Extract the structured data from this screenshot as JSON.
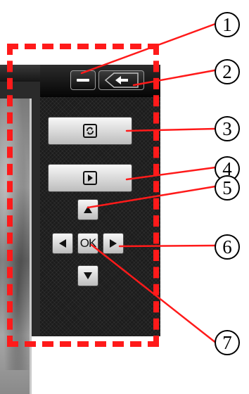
{
  "panel": {
    "ok_label": "OK"
  },
  "callouts": [
    {
      "label": "1"
    },
    {
      "label": "2"
    },
    {
      "label": "3"
    },
    {
      "label": "4"
    },
    {
      "label": "5"
    },
    {
      "label": "6"
    },
    {
      "label": "7"
    }
  ],
  "colors": {
    "callout_line": "#ff1a1a",
    "dashed_outline": "#ff1a1a",
    "panel_bg": "#1c1c1c"
  }
}
